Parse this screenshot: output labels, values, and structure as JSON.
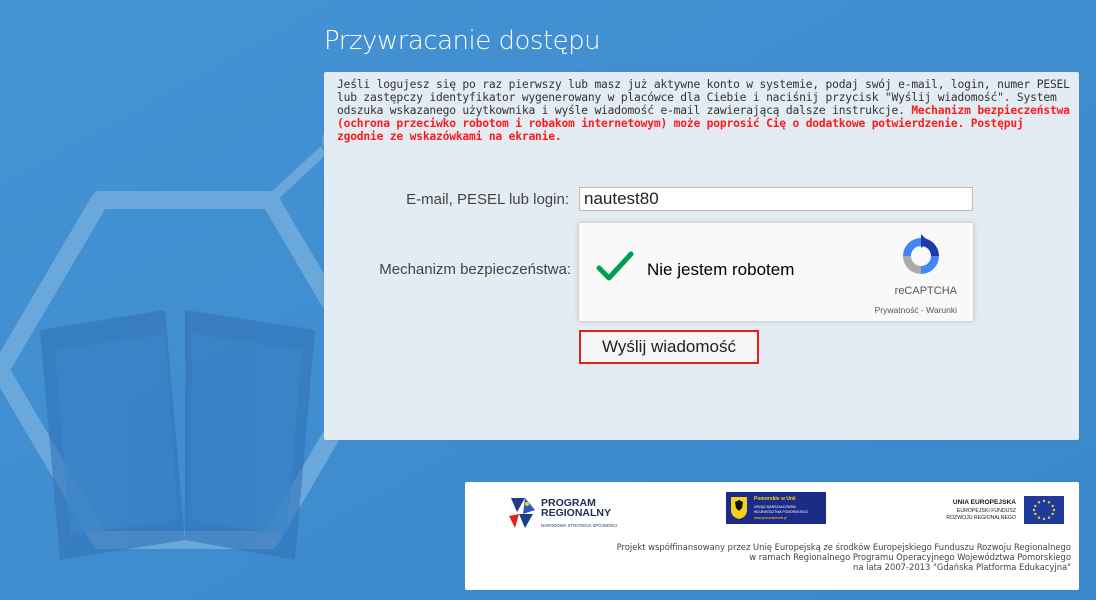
{
  "page": {
    "title": "Przywracanie dostępu"
  },
  "intro": {
    "text": "Jeśli logujesz się po raz pierwszy lub masz już aktywne konto w systemie, podaj swój e-mail, login, numer PESEL lub zastępczy identyfikator wygenerowany w placówce dla Ciebie i naciśnij przycisk \"Wyślij wiadomość\". System odszuka wskazanego użytkownika i wyśle wiadomość e-mail zawierającą dalsze instrukcje.",
    "warning": "Mechanizm bezpieczeństwa (ochrona przeciwko robotom i robakom internetowym) może poprosić Cię o dodatkowe potwierdzenie. Postępuj zgodnie ze wskazówkami na ekranie."
  },
  "form": {
    "email_label": "E-mail, PESEL lub login:",
    "email_value": "nautest80",
    "captcha_label": "Mechanizm bezpieczeństwa:",
    "submit_label": "Wyślij wiadomość"
  },
  "recaptcha": {
    "checkbox_label": "Nie jestem robotem",
    "brand": "reCAPTCHA",
    "privacy": "Prywatność",
    "separator": " - ",
    "terms": "Warunki",
    "checked": true
  },
  "footer": {
    "pr_title_1": "PROGRAM",
    "pr_title_2": "REGIONALNY",
    "pr_sub": "NARODOWA STRATEGIA SPÓJNOŚCI",
    "pom_title": "Pomorskie w Unii",
    "pom_line_1": "URZĄD MARSZAŁKOWSKI",
    "pom_line_2": "WOJEWÓDZTWA POMORSKIEGO",
    "pom_url": "www.pomorskieunii.pl",
    "eu_title": "UNIA EUROPEJSKA",
    "eu_line_1": "EUROPEJSKI FUNDUSZ",
    "eu_line_2": "ROZWOJU REGIONALNEGO",
    "project_line_1": "Projekt współfinansowany przez Unię Europejską ze środków Europejskiego Funduszu Rozwoju Regionalnego",
    "project_line_2": "w ramach Regionalnego Programu Operacyjnego Województwa Pomorskiego",
    "project_line_3": "na lata 2007-2013 \"Gdańska Platforma Edukacyjna\""
  },
  "colors": {
    "background": "#3f8fd0",
    "panel": "#e3ebf3",
    "warning": "#ff1a1a",
    "button_border": "#e41e1e",
    "check_green": "#009e55"
  },
  "icons": {
    "background_art": "hexagon-book-icon",
    "checkbox": "checkmark-icon",
    "recaptcha_logo": "recaptcha-logo-icon",
    "eu_flag": "eu-flag-icon"
  }
}
